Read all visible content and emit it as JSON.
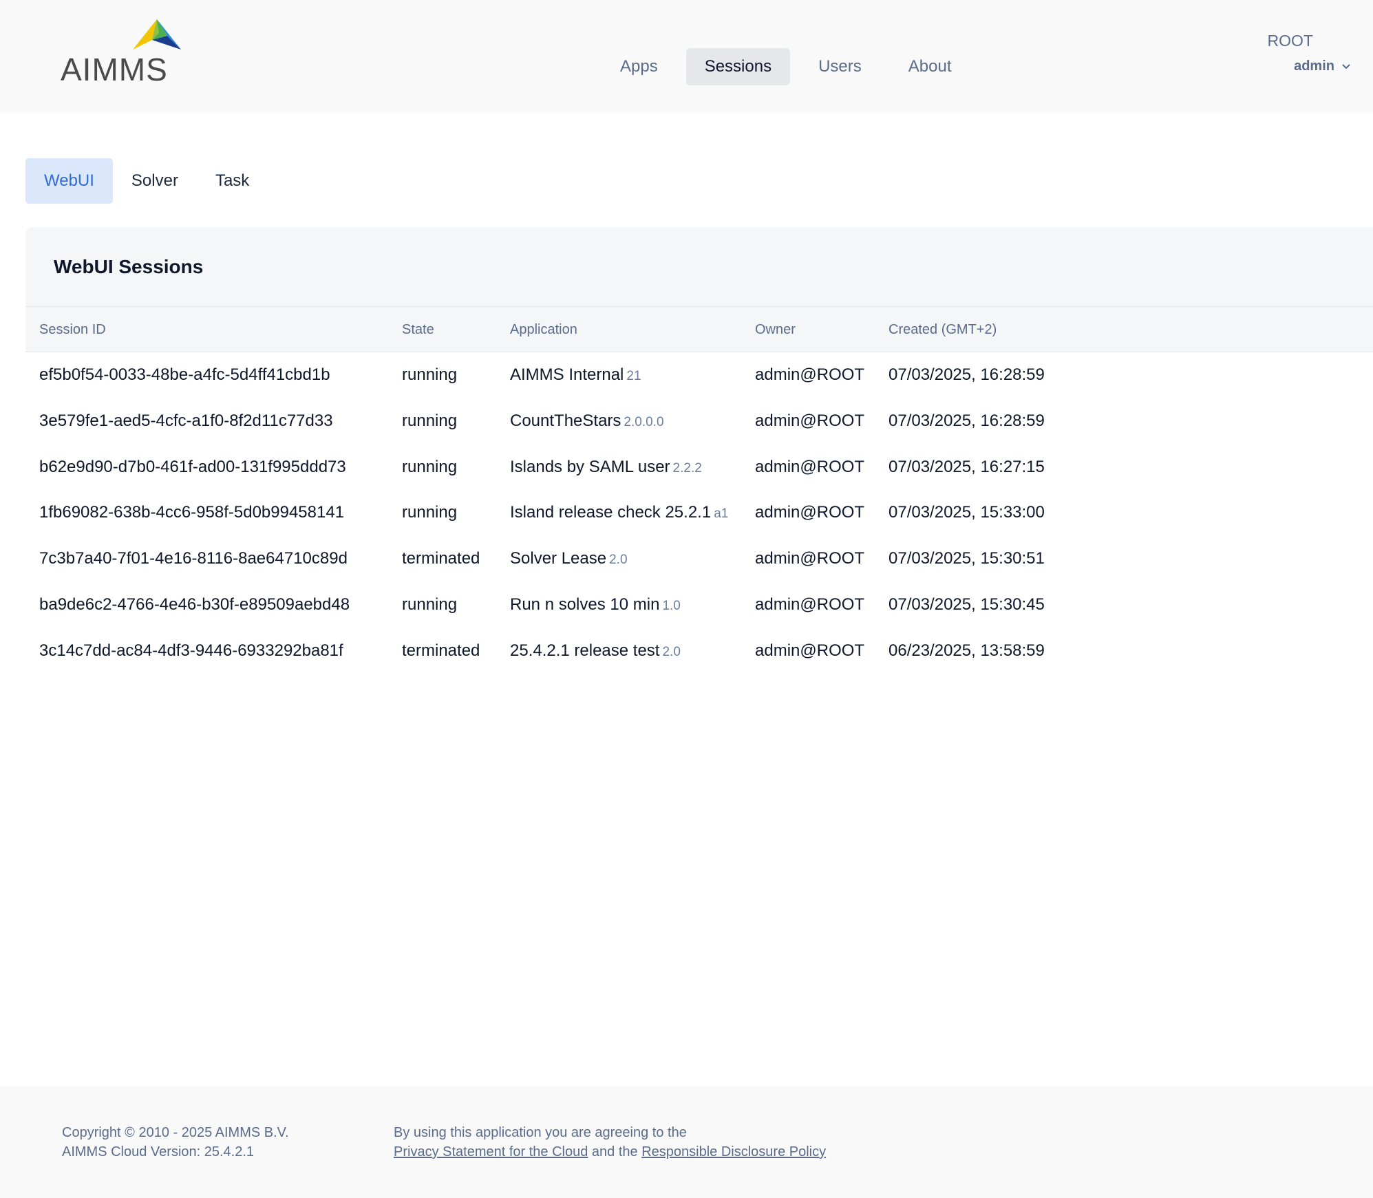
{
  "header": {
    "logo_text": "AIMMS",
    "nav": [
      {
        "label": "Apps"
      },
      {
        "label": "Sessions"
      },
      {
        "label": "Users"
      },
      {
        "label": "About"
      }
    ],
    "org": "ROOT",
    "user": "admin"
  },
  "subtabs": [
    {
      "label": "WebUI"
    },
    {
      "label": "Solver"
    },
    {
      "label": "Task"
    }
  ],
  "panel": {
    "title": "WebUI Sessions",
    "columns": [
      "Session ID",
      "State",
      "Application",
      "Owner",
      "Created (GMT+2)"
    ],
    "rows": [
      {
        "id": "ef5b0f54-0033-48be-a4fc-5d4ff41cbd1b",
        "state": "running",
        "app": "AIMMS Internal",
        "version": "21",
        "owner": "admin@ROOT",
        "created": "07/03/2025, 16:28:59"
      },
      {
        "id": "3e579fe1-aed5-4cfc-a1f0-8f2d11c77d33",
        "state": "running",
        "app": "CountTheStars",
        "version": "2.0.0.0",
        "owner": "admin@ROOT",
        "created": "07/03/2025, 16:28:59"
      },
      {
        "id": "b62e9d90-d7b0-461f-ad00-131f995ddd73",
        "state": "running",
        "app": "Islands by SAML user",
        "version": "2.2.2",
        "owner": "admin@ROOT",
        "created": "07/03/2025, 16:27:15"
      },
      {
        "id": "1fb69082-638b-4cc6-958f-5d0b99458141",
        "state": "running",
        "app": "Island release check 25.2.1",
        "version": "a1",
        "owner": "admin@ROOT",
        "created": "07/03/2025, 15:33:00"
      },
      {
        "id": "7c3b7a40-7f01-4e16-8116-8ae64710c89d",
        "state": "terminated",
        "app": "Solver Lease",
        "version": "2.0",
        "owner": "admin@ROOT",
        "created": "07/03/2025, 15:30:51"
      },
      {
        "id": "ba9de6c2-4766-4e46-b30f-e89509aebd48",
        "state": "running",
        "app": "Run n solves 10 min",
        "version": "1.0",
        "owner": "admin@ROOT",
        "created": "07/03/2025, 15:30:45"
      },
      {
        "id": "3c14c7dd-ac84-4df3-9446-6933292ba81f",
        "state": "terminated",
        "app": "25.4.2.1 release test",
        "version": "2.0",
        "owner": "admin@ROOT",
        "created": "06/23/2025, 13:58:59"
      }
    ]
  },
  "footer": {
    "copyright": "Copyright © 2010 - 2025 AIMMS B.V.",
    "version": "AIMMS Cloud Version: 25.4.2.1",
    "agree_text": "By using this application you are agreeing to the",
    "privacy_link": "Privacy Statement for the Cloud",
    "and_text": "and the",
    "disclosure_link": "Responsible Disclosure Policy"
  }
}
